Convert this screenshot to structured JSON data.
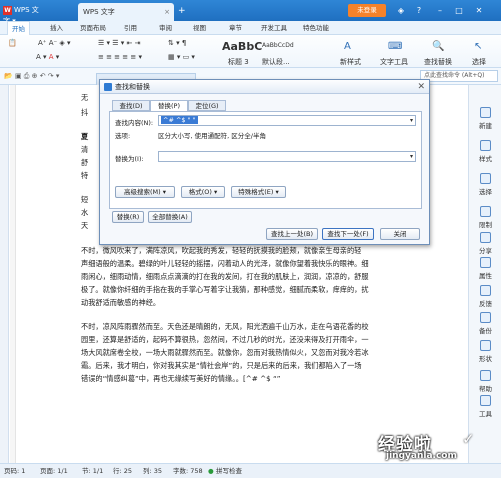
{
  "app": {
    "brand": "WPS 文字",
    "doc_tab": "WPS 文字",
    "login": "未登录"
  },
  "menu": [
    "开始",
    "插入",
    "页面布局",
    "引用",
    "审阅",
    "视图",
    "章节",
    "开发工具",
    "特色功能"
  ],
  "ribbon": {
    "style_preview_1": "AaBbC",
    "style_preview_2": "AaBbCcDd",
    "style_name_1": "标题 3",
    "style_name_2": "默认段...",
    "new_style": "新样式",
    "text_tools": "文字工具",
    "find_replace": "查找替换",
    "select": "选择"
  },
  "search_hint": "点此查找命令 (Alt+Q)",
  "right_sidebar": [
    "新建",
    "样式",
    "选择",
    "限制",
    "分享",
    "属性",
    "反馈",
    "备份",
    "形状",
    "帮助",
    "工具"
  ],
  "dialog": {
    "title": "查找和替换",
    "tabs": [
      "查找(D)",
      "替换(P)",
      "定位(G)"
    ],
    "find_label": "查找内容(N):",
    "find_value": "^# ^$ \"   \"",
    "options_label": "选项:",
    "options_value": "区分大小写, 使用通配符, 区分全/半角",
    "replace_label": "替换为(I):",
    "replace_value": "",
    "advanced": "高级搜索(M) ▾",
    "format": "格式(O) ▾",
    "special": "特殊格式(E) ▾",
    "replace_btn": "替换(R)",
    "replace_all_btn": "全部替换(A)",
    "prev_btn": "查找上一处(B)",
    "next_btn": "查找下一处(F)",
    "close_btn": "关闭"
  },
  "document": {
    "frag1": "无",
    "frag2": "抖",
    "frag3": "夏",
    "frag4": "清",
    "frag5": "舒",
    "frag6": "特",
    "frag7": "短",
    "frag8": "水",
    "frag9": "天",
    "para1": [
      "不时，微风吹来了，满阵凉风，吹起我的秀发，轻轻的抚摸我的脸颊，就像亲生母亲的轻",
      "声细语般的温柔。碧绿的叶儿轻轻的摇摆，闪着动人的光泽，就像你望着我快乐的眼神。细",
      "雨闲心，细雨动情，细雨点点滴滴的打在我的发间，打在我的肌肤上，润润，凉凉的，舒服",
      "极了。就像你纤细的手指在我的手掌心写着字让我猜，那种感觉，细腻而柔软，痒痒的，扰",
      "动我舒适而敏感的神经。"
    ],
    "para2": [
      "不时，凉风阵雨骤然而至。天色还是晴朗的，无风，阳光洒遍千山万水，走在乌语花香的校",
      "园里，还算是舒适的，起码不算很热，忽然间，不过几秒的时光，还没来得及打开雨伞，一",
      "场大风就席卷全校，一场大雨就骤然而至。就像你，忽而对我热情似火，又忽而对我冷若冰",
      "霜。后来，我才明白，你对我其实是“情社会岸”的，只是后来的后来，我们都陷入了一场",
      "错误的“情感纠葛”中，再也无缘续写美好的情缘。。[^# ^$ “”"
    ]
  },
  "status": {
    "page": "页码: 1",
    "pages": "页面: 1/1",
    "section": "节: 1/1",
    "row": "行: 25",
    "col": "列: 35",
    "chars": "字数: 758",
    "spell": "拼写检查"
  },
  "watermark": {
    "line1": "经验啦",
    "line2": "jingyanla.com",
    "check": "✓"
  }
}
